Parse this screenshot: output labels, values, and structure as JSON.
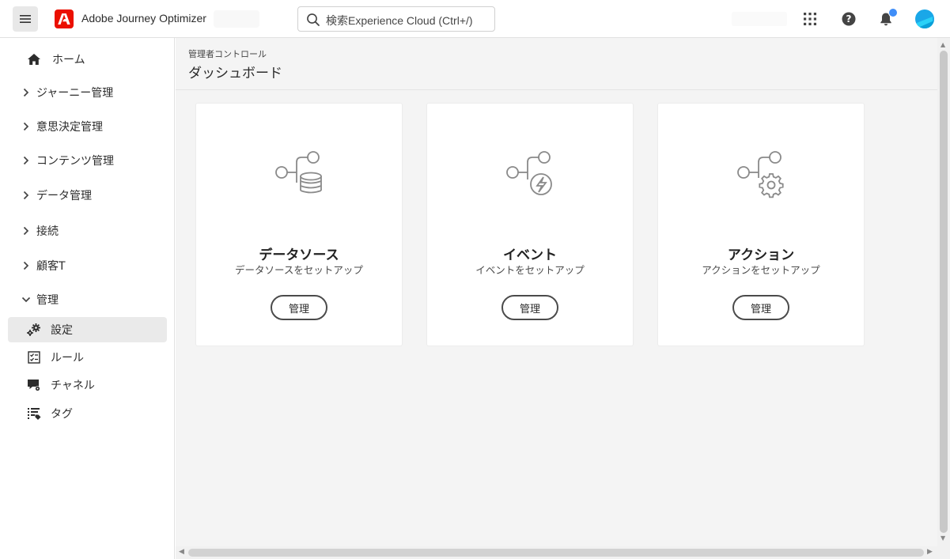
{
  "app": {
    "title": "Adobe Journey Optimizer",
    "brand_color": "#eb1000"
  },
  "search": {
    "placeholder": "検索Experience Cloud (Ctrl+/)"
  },
  "topbar_icons": [
    "menu-icon",
    "apps-grid-icon",
    "help-icon",
    "bell-icon",
    "avatar"
  ],
  "sidebar": {
    "items": [
      {
        "label": "ホーム",
        "icon": "home-icon",
        "type": "top"
      },
      {
        "label": "ジャーニー管理",
        "icon": "chevron-right-icon",
        "type": "group"
      },
      {
        "label": "意思決定管理",
        "icon": "chevron-right-icon",
        "type": "group"
      },
      {
        "label": "コンテンツ管理",
        "icon": "chevron-right-icon",
        "type": "group"
      },
      {
        "label": "データ管理",
        "icon": "chevron-right-icon",
        "type": "group"
      },
      {
        "label": "接続",
        "icon": "chevron-right-icon",
        "type": "group"
      },
      {
        "label": "顧客T",
        "icon": "chevron-right-icon",
        "type": "group"
      },
      {
        "label": "管理",
        "icon": "chevron-down-icon",
        "type": "group-open"
      },
      {
        "label": "設定",
        "icon": "gears-icon",
        "type": "sub",
        "active": true
      },
      {
        "label": "ルール",
        "icon": "checklist-icon",
        "type": "sub"
      },
      {
        "label": "チャネル",
        "icon": "channel-icon",
        "type": "sub"
      },
      {
        "label": "タグ",
        "icon": "tag-list-icon",
        "type": "sub"
      }
    ]
  },
  "header": {
    "breadcrumb": "管理者コントロール",
    "title": "ダッシュボード"
  },
  "cards": [
    {
      "title": "データソース",
      "description": "データソースをセットアップ",
      "button": "管理",
      "icon": "data-source-icon"
    },
    {
      "title": "イベント",
      "description": "イベントをセットアップ",
      "button": "管理",
      "icon": "event-icon"
    },
    {
      "title": "アクション",
      "description": "アクションをセットアップ",
      "button": "管理",
      "icon": "action-icon"
    }
  ]
}
